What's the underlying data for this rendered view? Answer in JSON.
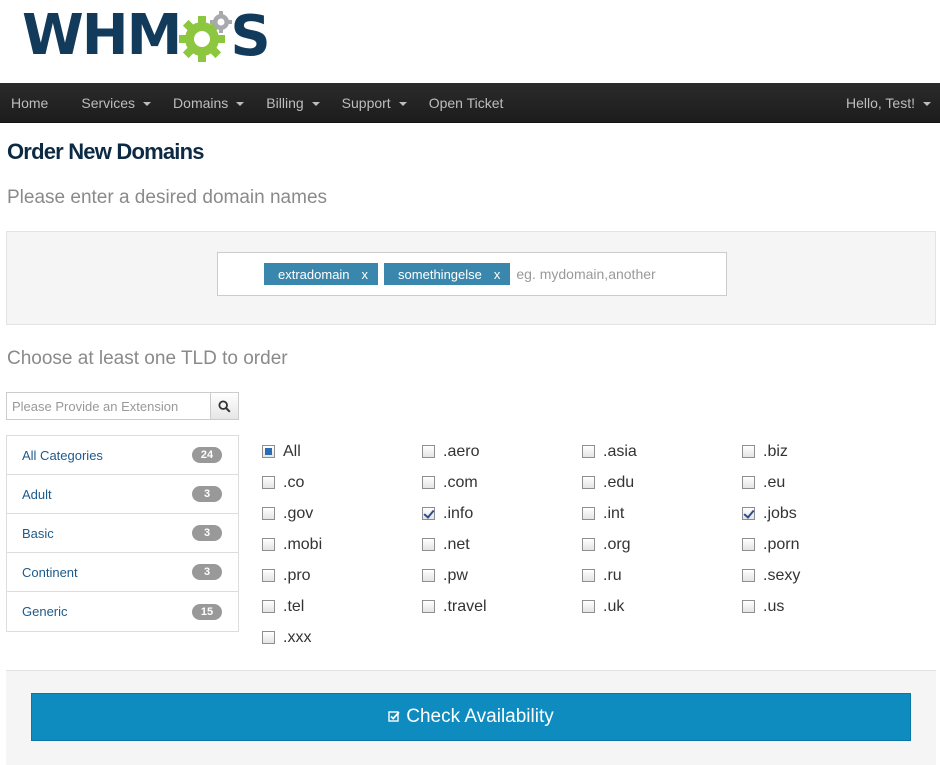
{
  "logo": {
    "text_left": "WHM",
    "text_right": "S"
  },
  "nav": {
    "home": "Home",
    "services": "Services",
    "domains": "Domains",
    "billing": "Billing",
    "support": "Support",
    "open_ticket": "Open Ticket",
    "user": "Hello, Test!"
  },
  "page": {
    "title": "Order New Domains",
    "subtitle": "Please enter a desired domain names",
    "tld_subtitle": "Choose at least one TLD to order"
  },
  "domain_input": {
    "tags": [
      "extradomain",
      "somethingelse"
    ],
    "remove_symbol": "x",
    "placeholder": "eg. mydomain,another"
  },
  "extension_search": {
    "placeholder": "Please Provide an Extension"
  },
  "categories": [
    {
      "label": "All Categories",
      "count": "24"
    },
    {
      "label": "Adult",
      "count": "3"
    },
    {
      "label": "Basic",
      "count": "3"
    },
    {
      "label": "Continent",
      "count": "3"
    },
    {
      "label": "Generic",
      "count": "15"
    }
  ],
  "tlds": [
    {
      "label": "All",
      "state": "partial"
    },
    {
      "label": ".aero",
      "state": "off"
    },
    {
      "label": ".asia",
      "state": "off"
    },
    {
      "label": ".biz",
      "state": "off"
    },
    {
      "label": ".co",
      "state": "off"
    },
    {
      "label": ".com",
      "state": "off"
    },
    {
      "label": ".edu",
      "state": "off"
    },
    {
      "label": ".eu",
      "state": "off"
    },
    {
      "label": ".gov",
      "state": "off"
    },
    {
      "label": ".info",
      "state": "checked"
    },
    {
      "label": ".int",
      "state": "off"
    },
    {
      "label": ".jobs",
      "state": "checked"
    },
    {
      "label": ".mobi",
      "state": "off"
    },
    {
      "label": ".net",
      "state": "off"
    },
    {
      "label": ".org",
      "state": "off"
    },
    {
      "label": ".porn",
      "state": "off"
    },
    {
      "label": ".pro",
      "state": "off"
    },
    {
      "label": ".pw",
      "state": "off"
    },
    {
      "label": ".ru",
      "state": "off"
    },
    {
      "label": ".sexy",
      "state": "off"
    },
    {
      "label": ".tel",
      "state": "off"
    },
    {
      "label": ".travel",
      "state": "off"
    },
    {
      "label": ".uk",
      "state": "off"
    },
    {
      "label": ".us",
      "state": "off"
    },
    {
      "label": ".xxx",
      "state": "off"
    }
  ],
  "check_button": {
    "label": "Check Availability",
    "icon": "check-square-icon"
  },
  "colors": {
    "brand_navy": "#123b5b",
    "brand_green": "#8dc63f",
    "button_blue": "#0e8cc0",
    "tag_blue": "#3a87ad"
  }
}
